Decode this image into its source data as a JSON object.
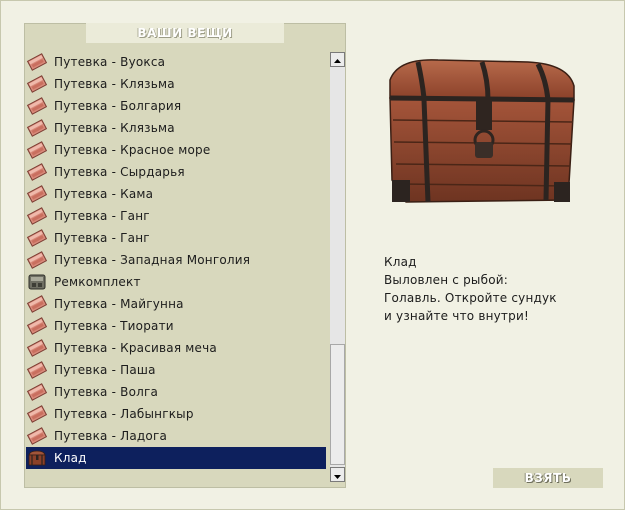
{
  "panel": {
    "title": "ВАШИ ВЕЩИ"
  },
  "items": [
    {
      "label": "Путевка - Вуокса",
      "icon": "voucher-icon"
    },
    {
      "label": "Путевка - Клязьма",
      "icon": "voucher-icon"
    },
    {
      "label": "Путевка - Болгария",
      "icon": "voucher-icon"
    },
    {
      "label": "Путевка - Клязьма",
      "icon": "voucher-icon"
    },
    {
      "label": "Путевка - Красное море",
      "icon": "voucher-icon"
    },
    {
      "label": "Путевка - Сырдарья",
      "icon": "voucher-icon"
    },
    {
      "label": "Путевка - Кама",
      "icon": "voucher-icon"
    },
    {
      "label": "Путевка - Ганг",
      "icon": "voucher-icon"
    },
    {
      "label": "Путевка - Ганг",
      "icon": "voucher-icon"
    },
    {
      "label": "Путевка - Западная Монголия",
      "icon": "voucher-icon"
    },
    {
      "label": "Ремкомплект",
      "icon": "repair-kit-icon"
    },
    {
      "label": "Путевка - Майгунна",
      "icon": "voucher-icon"
    },
    {
      "label": "Путевка - Тиорати",
      "icon": "voucher-icon"
    },
    {
      "label": "Путевка - Красивая меча",
      "icon": "voucher-icon"
    },
    {
      "label": "Путевка - Паша",
      "icon": "voucher-icon"
    },
    {
      "label": "Путевка - Волга",
      "icon": "voucher-icon"
    },
    {
      "label": "Путевка - Лабынгкыр",
      "icon": "voucher-icon"
    },
    {
      "label": "Путевка - Ладога",
      "icon": "voucher-icon"
    },
    {
      "label": "Клад",
      "icon": "chest-icon",
      "selected": true
    }
  ],
  "detail": {
    "name": "Клад",
    "line1": "Выловлен с рыбой:",
    "line2": "Голавль. Откройте сундук",
    "line3": "и узнайте что внутри!",
    "image_icon": "treasure-chest-icon"
  },
  "take_button": "ВЗЯТЬ",
  "colors": {
    "panel": "#d8d8bd",
    "selected": "#0d205d",
    "background": "#f1f1e4"
  }
}
